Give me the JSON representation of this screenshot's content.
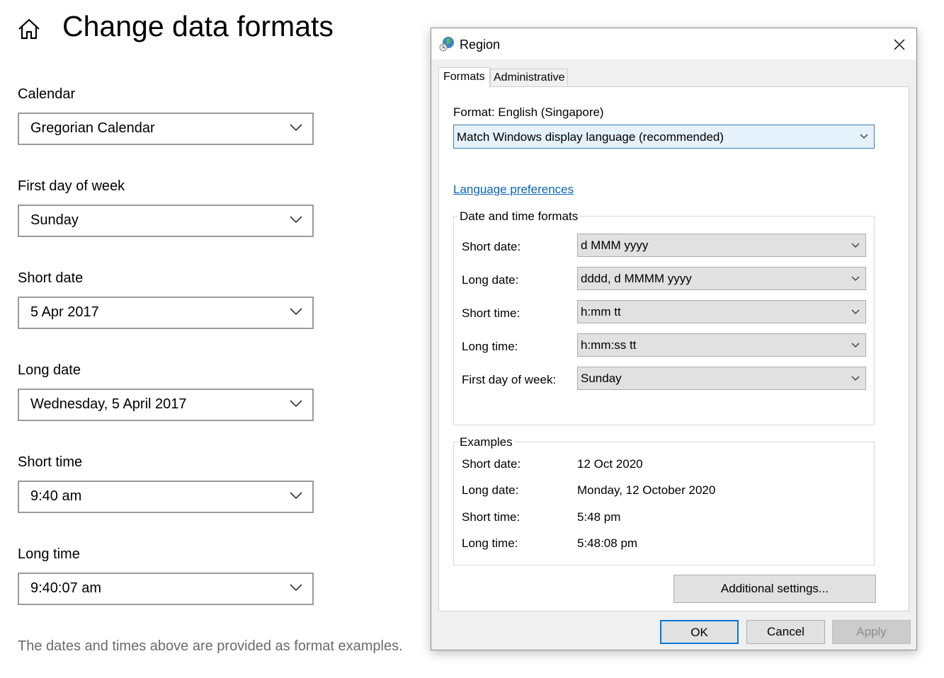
{
  "settings": {
    "title": "Change data formats",
    "fields": [
      {
        "label": "Calendar",
        "value": "Gregorian Calendar"
      },
      {
        "label": "First day of week",
        "value": "Sunday"
      },
      {
        "label": "Short date",
        "value": "5 Apr 2017"
      },
      {
        "label": "Long date",
        "value": "Wednesday, 5 April 2017"
      },
      {
        "label": "Short time",
        "value": "9:40 am"
      },
      {
        "label": "Long time",
        "value": "9:40:07 am"
      }
    ],
    "footnote": "The dates and times above are provided as format examples."
  },
  "dialog": {
    "title": "Region",
    "close_glyph": "✕",
    "tabs": [
      {
        "label": "Formats",
        "active": true
      },
      {
        "label": "Administrative",
        "active": false
      }
    ],
    "format_label": "Format: English (Singapore)",
    "format_value": "Match Windows display language (recommended)",
    "language_link": "Language preferences",
    "date_time_group_title": "Date and time formats",
    "date_time_rows": [
      {
        "label": "Short date:",
        "value": "d MMM yyyy"
      },
      {
        "label": "Long date:",
        "value": "dddd, d MMMM yyyy"
      },
      {
        "label": "Short time:",
        "value": "h:mm tt"
      },
      {
        "label": "Long time:",
        "value": "h:mm:ss tt"
      },
      {
        "label": "First day of week:",
        "value": "Sunday"
      }
    ],
    "examples_group_title": "Examples",
    "examples": [
      {
        "label": "Short date:",
        "value": "12 Oct 2020"
      },
      {
        "label": "Long date:",
        "value": "Monday, 12 October 2020"
      },
      {
        "label": "Short time:",
        "value": "5:48 pm"
      },
      {
        "label": "Long time:",
        "value": "5:48:08 pm"
      }
    ],
    "buttons": {
      "additional": "Additional settings...",
      "ok": "OK",
      "cancel": "Cancel",
      "apply": "Apply"
    },
    "colors": {
      "link": "#0a64b8",
      "focus_border": "#0078d7",
      "selected_bg": "#e5f1fb"
    }
  },
  "icons": {
    "home": "home-icon",
    "chevron": "chevron-down-icon",
    "region": "globe-icon",
    "close": "close-icon"
  }
}
